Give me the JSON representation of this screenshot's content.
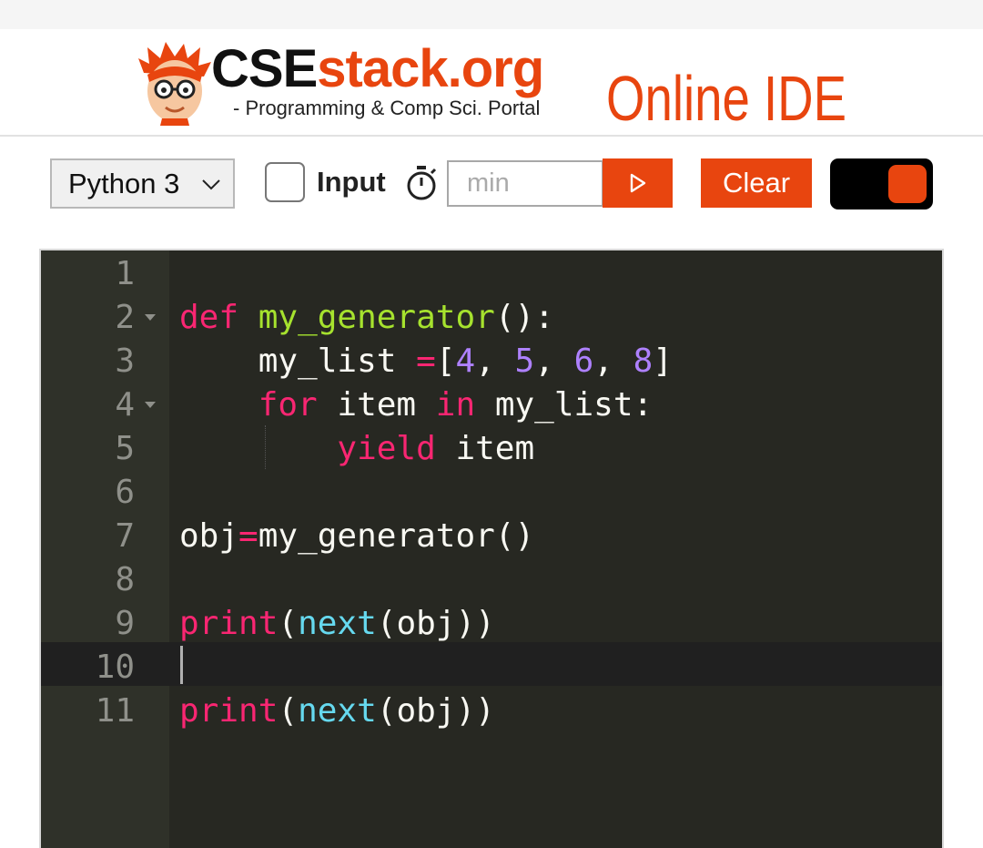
{
  "header": {
    "brand_cse": "CSE",
    "brand_rest": "stack.org",
    "tagline": "- Programming & Comp Sci. Portal",
    "ide_title": "Online IDE",
    "accent_color": "#e8450f"
  },
  "toolbar": {
    "language": "Python 3",
    "input_label": "Input",
    "timer_placeholder": "min",
    "run_icon": "play-icon",
    "clear_label": "Clear",
    "toggle_state": "on"
  },
  "editor": {
    "theme": "monokai",
    "active_line": 10,
    "line_numbers": [
      "1",
      "2",
      "3",
      "4",
      "5",
      "6",
      "7",
      "8",
      "9",
      "10",
      "11"
    ],
    "folded_lines": [
      2,
      4
    ],
    "lines": [
      {
        "tokens": []
      },
      {
        "tokens": [
          {
            "t": "kw",
            "v": "def"
          },
          {
            "t": "plain",
            "v": " "
          },
          {
            "t": "fn",
            "v": "my_generator"
          },
          {
            "t": "plain",
            "v": "():"
          }
        ]
      },
      {
        "tokens": [
          {
            "t": "plain",
            "v": "    my_list "
          },
          {
            "t": "kw",
            "v": "="
          },
          {
            "t": "plain",
            "v": "["
          },
          {
            "t": "num",
            "v": "4"
          },
          {
            "t": "plain",
            "v": ", "
          },
          {
            "t": "num",
            "v": "5"
          },
          {
            "t": "plain",
            "v": ", "
          },
          {
            "t": "num",
            "v": "6"
          },
          {
            "t": "plain",
            "v": ", "
          },
          {
            "t": "num",
            "v": "8"
          },
          {
            "t": "plain",
            "v": "]"
          }
        ]
      },
      {
        "tokens": [
          {
            "t": "plain",
            "v": "    "
          },
          {
            "t": "kw",
            "v": "for"
          },
          {
            "t": "plain",
            "v": " item "
          },
          {
            "t": "kw",
            "v": "in"
          },
          {
            "t": "plain",
            "v": " my_list:"
          }
        ]
      },
      {
        "tokens": [
          {
            "t": "plain",
            "v": "        "
          },
          {
            "t": "kw",
            "v": "yield"
          },
          {
            "t": "plain",
            "v": " item"
          }
        ]
      },
      {
        "tokens": []
      },
      {
        "tokens": [
          {
            "t": "plain",
            "v": "obj"
          },
          {
            "t": "kw",
            "v": "="
          },
          {
            "t": "plain",
            "v": "my_generator()"
          }
        ]
      },
      {
        "tokens": []
      },
      {
        "tokens": [
          {
            "t": "kw",
            "v": "print"
          },
          {
            "t": "plain",
            "v": "("
          },
          {
            "t": "bi",
            "v": "next"
          },
          {
            "t": "plain",
            "v": "(obj))"
          }
        ]
      },
      {
        "tokens": []
      },
      {
        "tokens": [
          {
            "t": "kw",
            "v": "print"
          },
          {
            "t": "plain",
            "v": "("
          },
          {
            "t": "bi",
            "v": "next"
          },
          {
            "t": "plain",
            "v": "(obj))"
          }
        ]
      }
    ]
  }
}
